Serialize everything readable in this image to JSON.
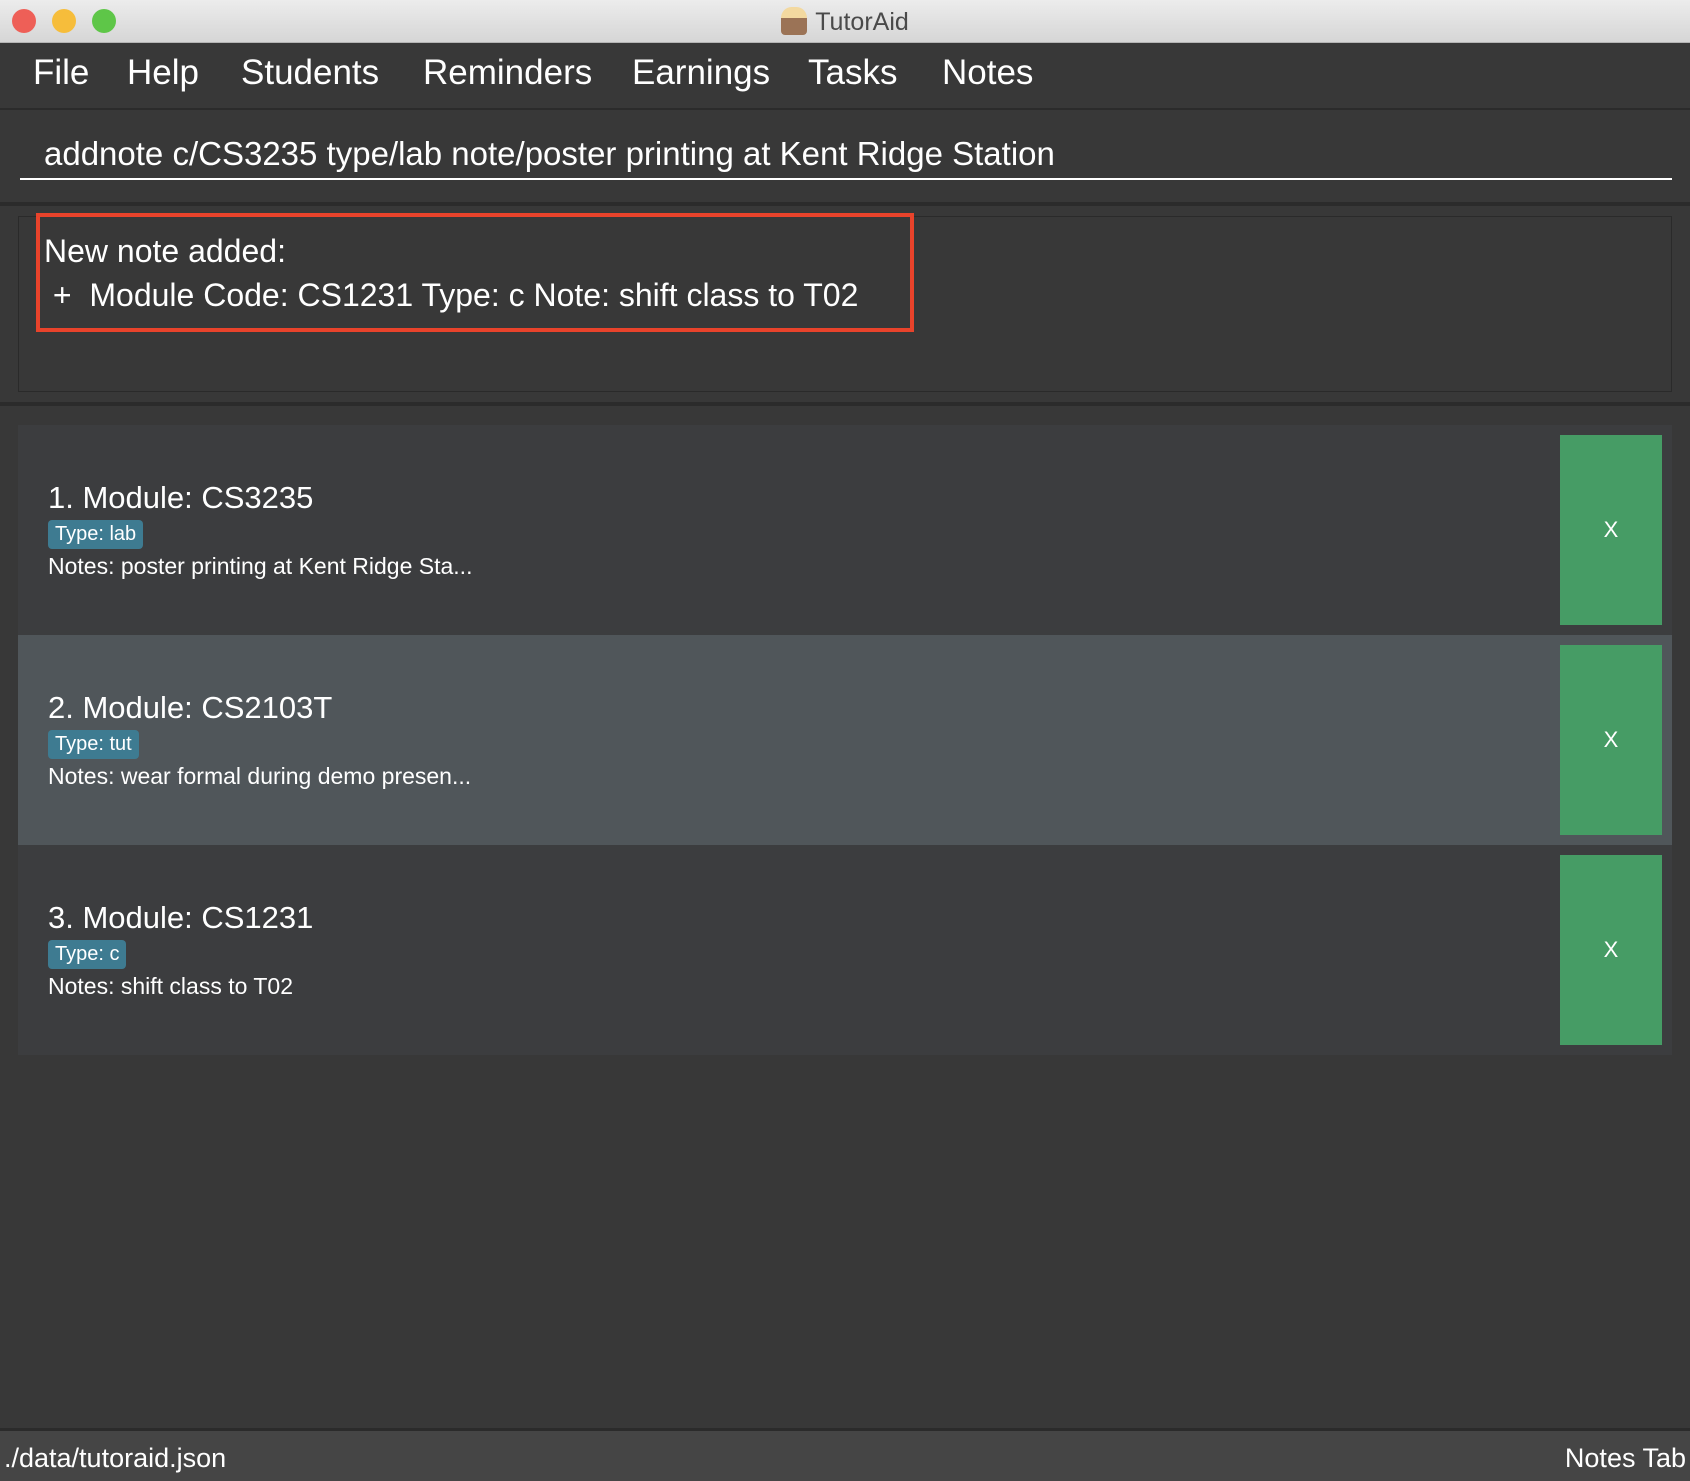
{
  "window": {
    "title": "TutorAid",
    "icon": "tutor-avatar-icon"
  },
  "menu": [
    "File",
    "Help",
    "Students",
    "Reminders",
    "Earnings",
    "Tasks",
    "Notes"
  ],
  "command": {
    "value": "addnote c/CS3235 type/lab note/poster printing at Kent Ridge Station"
  },
  "result": {
    "line1": "New note added:",
    "line2": " +  Module Code: CS1231 Type: c Note: shift class to T02"
  },
  "notes": [
    {
      "title": "1.  Module: CS3235",
      "type": "Type: lab",
      "notes": "Notes: poster printing at Kent Ridge Sta...",
      "delete": "X"
    },
    {
      "title": "2.  Module: CS2103T",
      "type": "Type: tut",
      "notes": "Notes: wear formal during demo presen...",
      "delete": "X"
    },
    {
      "title": "3.  Module: CS1231",
      "type": "Type: c",
      "notes": "Notes: shift class to T02",
      "delete": "X"
    }
  ],
  "status": {
    "path": "./data/tutoraid.json",
    "tab": "Notes Tab"
  },
  "colors": {
    "highlight": "#e8432b",
    "tag": "#3e7b91",
    "delete_button": "#469c65",
    "selected_card": "#50565a"
  }
}
